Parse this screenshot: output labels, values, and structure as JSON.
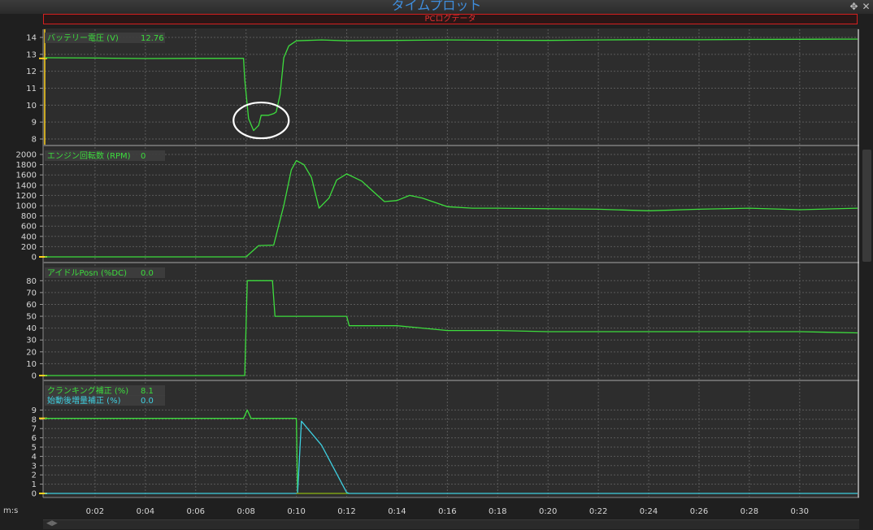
{
  "window": {
    "title": "タイムプロット",
    "log_label": "PCログデータ",
    "move_icon": "move-icon",
    "close_icon": "close-icon"
  },
  "time_axis_label": "m:s",
  "colors": {
    "background": "#2d2d2d",
    "grid": "#5a5a5a",
    "green": "#3ddc3d",
    "cyan": "#3ecfe0",
    "olive": "#8a9a10",
    "yellow": "#ffd21f",
    "title_blue": "#3f8ede",
    "log_red": "#e03030"
  },
  "chart_data": [
    {
      "type": "line",
      "series": [
        {
          "name": "バッテリー電圧 (V)",
          "current_value": "12.76",
          "color": "#3ddc3d",
          "x": [
            0,
            2,
            4,
            6,
            7.9,
            7.95,
            8.1,
            8.3,
            8.5,
            8.6,
            8.9,
            9.1,
            9.2,
            9.35,
            9.5,
            9.7,
            10,
            11,
            12,
            14,
            16,
            18,
            20,
            22,
            24,
            26,
            28,
            30,
            31.6,
            32.3
          ],
          "y": [
            12.8,
            12.78,
            12.75,
            12.76,
            12.76,
            11.5,
            9.2,
            8.5,
            8.8,
            9.4,
            9.4,
            9.5,
            9.6,
            10.6,
            12.8,
            13.5,
            13.8,
            13.85,
            13.8,
            13.82,
            13.85,
            13.83,
            13.82,
            13.85,
            13.87,
            13.86,
            13.88,
            13.89,
            13.9,
            13.9
          ]
        }
      ],
      "ylim": [
        8,
        14
      ],
      "yticks": [
        8,
        9,
        10,
        11,
        12,
        13,
        14
      ],
      "marker": 12.76,
      "annotation": {
        "shape": "ellipse",
        "x": 8.6,
        "y": 9.1
      }
    },
    {
      "type": "line",
      "series": [
        {
          "name": "エンジン回転数 (RPM)",
          "current_value": "0",
          "color": "#3ddc3d",
          "x": [
            0,
            8,
            8.5,
            9.1,
            9.5,
            9.8,
            10,
            10.3,
            10.6,
            10.9,
            11.3,
            11.6,
            12,
            12.3,
            12.6,
            13,
            13.5,
            14,
            14.5,
            15,
            16,
            17,
            18,
            20,
            22,
            24,
            26,
            28,
            30,
            32.3
          ],
          "y": [
            0,
            0,
            220,
            230,
            1000,
            1700,
            1880,
            1800,
            1550,
            950,
            1150,
            1500,
            1620,
            1550,
            1480,
            1300,
            1080,
            1100,
            1200,
            1150,
            980,
            950,
            950,
            940,
            930,
            900,
            930,
            950,
            920,
            950
          ]
        }
      ],
      "ylim": [
        0,
        2000
      ],
      "yticks": [
        0,
        200,
        400,
        600,
        800,
        1000,
        1200,
        1400,
        1600,
        1800,
        2000
      ]
    },
    {
      "type": "line",
      "series": [
        {
          "name": "アイドルPosn (%DC)",
          "current_value": "0.0",
          "color": "#3ddc3d",
          "x": [
            0,
            7.95,
            8.05,
            9.05,
            9.15,
            12,
            12.1,
            14,
            15,
            16,
            18,
            20,
            22,
            24,
            26,
            28,
            30,
            32.3
          ],
          "y": [
            0,
            0,
            80,
            80,
            50,
            50,
            42,
            42,
            40,
            38,
            38,
            37,
            37,
            37,
            37,
            37,
            37,
            36
          ]
        }
      ],
      "ylim": [
        0,
        85
      ],
      "yticks": [
        0,
        10,
        20,
        30,
        40,
        50,
        60,
        70,
        80
      ]
    },
    {
      "type": "line",
      "series": [
        {
          "name": "クランキング補正 (%)",
          "current_value": "8.1",
          "color": "#3ddc3d",
          "x": [
            0,
            7.9,
            8.05,
            8.2,
            10.0,
            10.05,
            10.2,
            12.0,
            12.1
          ],
          "y": [
            8.1,
            8.1,
            9.0,
            8.1,
            8.1,
            0,
            0,
            0,
            0
          ]
        },
        {
          "name": "始動後増量補正 (%)",
          "current_value": "0.0",
          "color": "#3ecfe0",
          "x": [
            0,
            10.0,
            10.05,
            10.2,
            11.0,
            12.0,
            12.1,
            14,
            20,
            26,
            32.3
          ],
          "y": [
            0,
            0,
            0,
            7.8,
            5.2,
            0.1,
            0,
            0,
            0,
            0,
            0
          ]
        },
        {
          "name": "",
          "color": "#8a9a10",
          "x": [
            10.0,
            12.0
          ],
          "y": [
            0,
            0
          ]
        }
      ],
      "ylim": [
        0,
        10
      ],
      "yticks": [
        0,
        1,
        2,
        3,
        4,
        5,
        6,
        7,
        8,
        9
      ],
      "marker": 8.1
    }
  ],
  "xaxis": {
    "ticks": [
      2,
      4,
      6,
      8,
      10,
      12,
      14,
      16,
      18,
      20,
      22,
      24,
      26,
      28,
      30
    ],
    "tick_labels": [
      "0:02",
      "0:04",
      "0:06",
      "0:08",
      "0:10",
      "0:12",
      "0:14",
      "0:16",
      "0:18",
      "0:20",
      "0:22",
      "0:24",
      "0:26",
      "0:28",
      "0:30"
    ],
    "xlim": [
      0,
      32.3
    ]
  }
}
